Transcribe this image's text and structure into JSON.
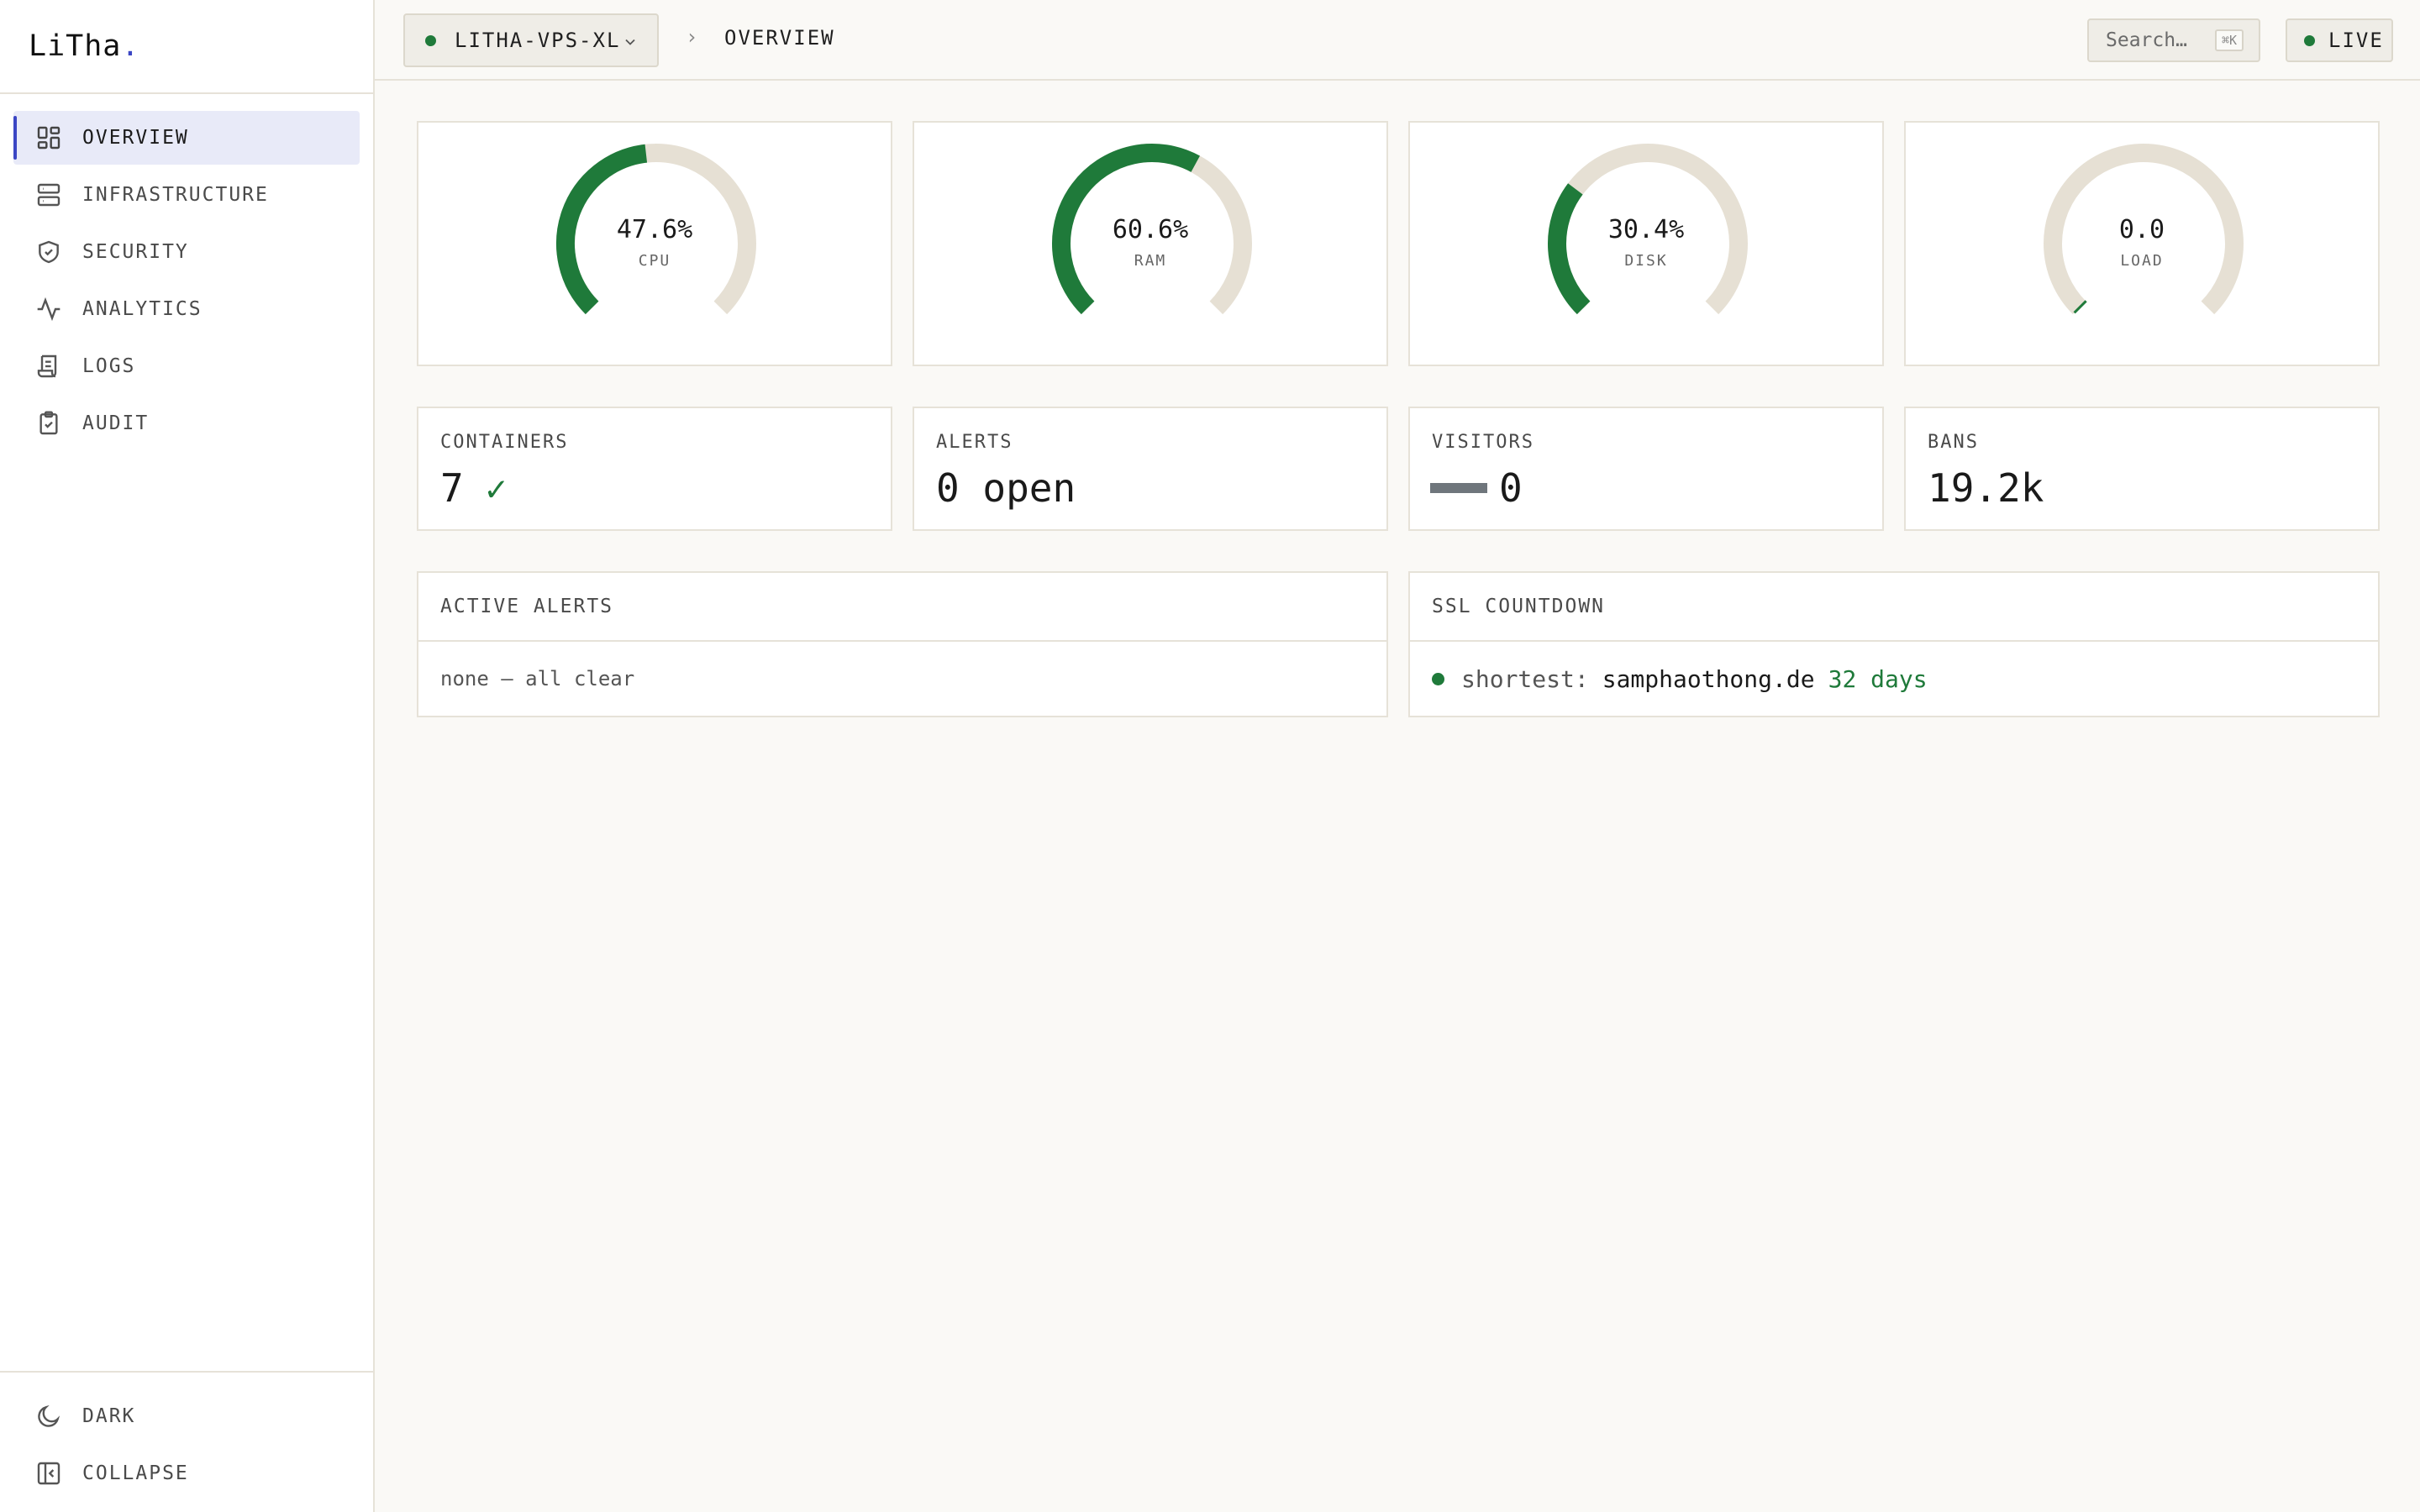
{
  "brand": {
    "name": "LiTha",
    "dot": "."
  },
  "sidebar": {
    "items": [
      {
        "label": "OVERVIEW",
        "icon": "dashboard-icon",
        "active": true
      },
      {
        "label": "INFRASTRUCTURE",
        "icon": "server-icon"
      },
      {
        "label": "SECURITY",
        "icon": "shield-icon"
      },
      {
        "label": "ANALYTICS",
        "icon": "activity-icon"
      },
      {
        "label": "LOGS",
        "icon": "scroll-icon"
      },
      {
        "label": "AUDIT",
        "icon": "clipboard-check-icon"
      }
    ],
    "bottom": [
      {
        "label": "DARK",
        "icon": "moon-icon"
      },
      {
        "label": "COLLAPSE",
        "icon": "collapse-icon"
      }
    ]
  },
  "topbar": {
    "server": "LITHA-VPS-XL",
    "breadcrumb_sep": "›",
    "breadcrumb": "OVERVIEW",
    "search_placeholder": "Search…",
    "search_shortcut": "⌘K",
    "live_label": "LIVE"
  },
  "gauges": [
    {
      "value": "47.6%",
      "label": "CPU",
      "percent": 47.6
    },
    {
      "value": "60.6%",
      "label": "RAM",
      "percent": 60.6
    },
    {
      "value": "30.4%",
      "label": "DISK",
      "percent": 30.4
    },
    {
      "value": "0.0",
      "label": "LOAD",
      "percent": 0.0
    }
  ],
  "stats": {
    "containers": {
      "label": "CONTAINERS",
      "value": "7",
      "mark": "✓"
    },
    "alerts": {
      "label": "ALERTS",
      "value": "0 open"
    },
    "visitors": {
      "label": "VISITORS",
      "value": "0"
    },
    "bans": {
      "label": "BANS",
      "value": "19.2k"
    }
  },
  "active_alerts": {
    "title": "ACTIVE ALERTS",
    "body": "none — all clear"
  },
  "ssl": {
    "title": "SSL COUNTDOWN",
    "prefix": "shortest:",
    "domain": "samphaothong.de",
    "days": "32 days"
  },
  "colors": {
    "accent": "#3b46c4",
    "ok": "#1f7a3a",
    "track": "#e6e0d4"
  }
}
